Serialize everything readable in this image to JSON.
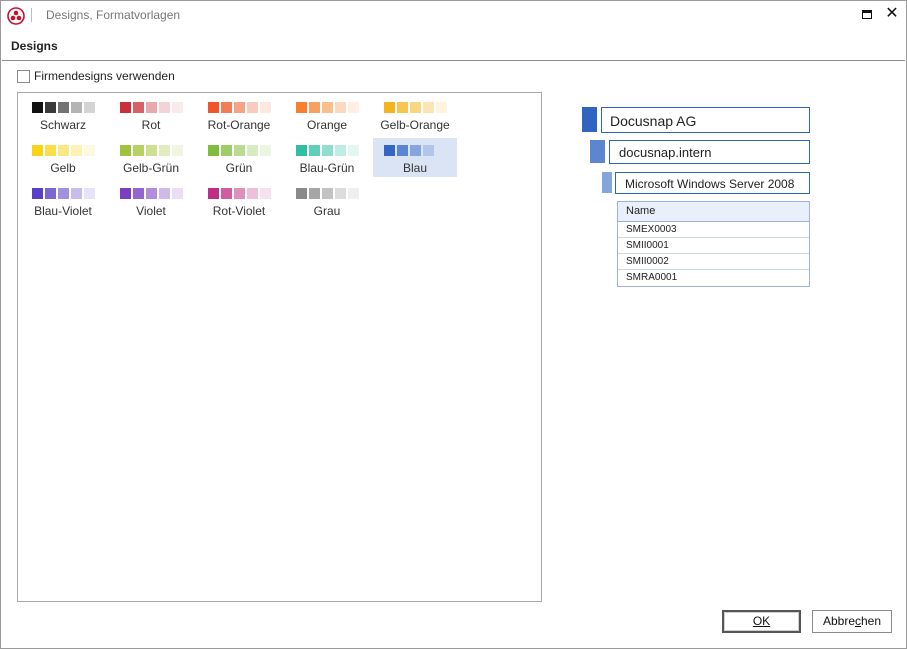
{
  "window": {
    "title": "Designs, Formatvorlagen",
    "section_title": "Designs",
    "icon": "app-logo-icon",
    "maximize_icon": "maximize-icon",
    "close_icon": "close-icon",
    "close_glyph": "✕"
  },
  "company_designs": {
    "label": "Firmendesigns verwenden",
    "checked": false
  },
  "designs": [
    {
      "label": "Schwarz",
      "colors": [
        "#111111",
        "#3a3a3a",
        "#737373",
        "#b4b4b4",
        "#d4d4d4"
      ],
      "selected": false
    },
    {
      "label": "Rot",
      "colors": [
        "#c9303a",
        "#d86168",
        "#e8a9ad",
        "#f3d3d5",
        "#f9eaeb"
      ],
      "selected": false
    },
    {
      "label": "Rot-Orange",
      "colors": [
        "#f0552c",
        "#f27b58",
        "#f5a287",
        "#f9cbbc",
        "#fde7de"
      ],
      "selected": false
    },
    {
      "label": "Orange",
      "colors": [
        "#f77f2d",
        "#f9a060",
        "#fbbf8f",
        "#fcd9bd",
        "#feefe2"
      ],
      "selected": false
    },
    {
      "label": "Gelb-Orange",
      "colors": [
        "#f7b21f",
        "#f9c44f",
        "#fbd582",
        "#fde5b3",
        "#fef3dc"
      ],
      "selected": false
    },
    {
      "label": "Gelb",
      "colors": [
        "#f7d416",
        "#f9df4c",
        "#fbe882",
        "#fdf1b6",
        "#fef9de"
      ],
      "selected": false
    },
    {
      "label": "Gelb-Grün",
      "colors": [
        "#9fc33a",
        "#b6d265",
        "#cde091",
        "#e1ecbe",
        "#f1f6e0"
      ],
      "selected": false
    },
    {
      "label": "Grün",
      "colors": [
        "#7fbd3c",
        "#9ccd68",
        "#b9dc94",
        "#d6ebc0",
        "#ecf5e1"
      ],
      "selected": false
    },
    {
      "label": "Blau-Grün",
      "colors": [
        "#2fbfa5",
        "#5fcfba",
        "#8fdecf",
        "#bfece3",
        "#e2f6f2"
      ],
      "selected": false
    },
    {
      "label": "Blau",
      "colors": [
        "#3366c6",
        "#5a85d2",
        "#84a5de",
        "#b0c6ea",
        "#dae4f5"
      ],
      "selected": true
    },
    {
      "label": "Blau-Violet",
      "colors": [
        "#5840c8",
        "#7b67d4",
        "#a092e0",
        "#c6bdec",
        "#e6e2f7"
      ],
      "selected": false
    },
    {
      "label": "Violet",
      "colors": [
        "#7a3dc4",
        "#9564d0",
        "#b18edd",
        "#cfbaea",
        "#e9def6"
      ],
      "selected": false
    },
    {
      "label": "Rot-Violet",
      "colors": [
        "#c02d86",
        "#cf5da0",
        "#de8fbd",
        "#ecc0da",
        "#f6e2ee"
      ],
      "selected": false
    },
    {
      "label": "Grau",
      "colors": [
        "#8a8a8a",
        "#a6a6a6",
        "#c2c2c2",
        "#dcdcdc",
        "#efefef"
      ],
      "selected": false
    }
  ],
  "preview": {
    "level1": "Docusnap AG",
    "level2": "docusnap.intern",
    "level3": "Microsoft Windows Server 2008",
    "table_header": "Name",
    "rows": [
      "SMEX0003",
      "SMII0001",
      "SMII0002",
      "SMRA0001"
    ],
    "block_colors": [
      "#2f65c1",
      "#5c86d0",
      "#85a5dd"
    ]
  },
  "buttons": {
    "ok_label": "OK",
    "cancel_prefix": "Abbre",
    "cancel_mnemonic": "c",
    "cancel_suffix": "hen"
  }
}
